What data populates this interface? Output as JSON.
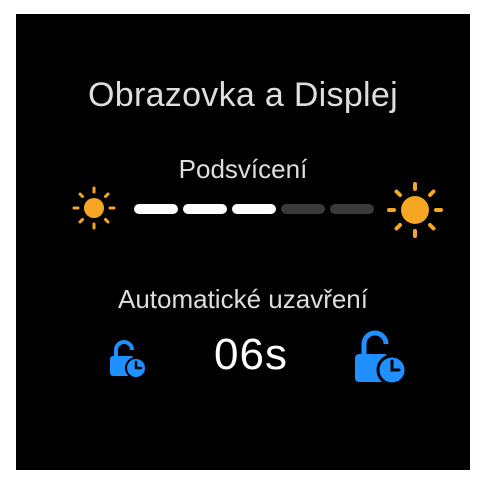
{
  "screen": {
    "title": "Obrazovka a Displej",
    "backlight": {
      "label": "Podsvícení",
      "level": 3,
      "max_level": 5,
      "decrease_icon": "sun-small-icon",
      "increase_icon": "sun-large-icon"
    },
    "autolock": {
      "label": "Automatické uzavření",
      "value": "06s",
      "decrease_icon": "lock-timer-small-icon",
      "increase_icon": "lock-timer-large-icon"
    }
  },
  "colors": {
    "background": "#000000",
    "text": "#dedede",
    "sun": "#f5a623",
    "lock": "#1e90ff",
    "segment_on": "#ffffff",
    "segment_off": "#3a3a3a"
  }
}
